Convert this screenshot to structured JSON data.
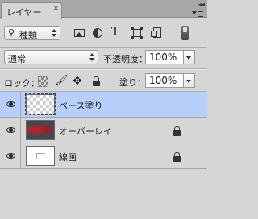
{
  "panel": {
    "tab_label": "レイヤー",
    "tab_close": "✕",
    "collapse": "◂◂"
  },
  "filter": {
    "kind_label": "種類",
    "icons": [
      "pixel-layer-filter-icon",
      "adjustment-layer-filter-icon",
      "type-layer-filter-icon",
      "shape-layer-filter-icon",
      "smart-object-filter-icon"
    ],
    "type_glyph": "T"
  },
  "blend": {
    "mode": "通常",
    "opacity_label": "不透明度：",
    "opacity_value": "100%"
  },
  "lock": {
    "label": "ロック：",
    "fill_label": "塗り：",
    "fill_value": "100%"
  },
  "layers": [
    {
      "name": "ベース塗り",
      "selected": true,
      "locked": false,
      "visible": true
    },
    {
      "name": "オーバーレイ",
      "selected": false,
      "locked": true,
      "visible": true
    },
    {
      "name": "線画",
      "selected": false,
      "locked": true,
      "visible": true
    }
  ],
  "colors": {
    "panel_bg": "#d6d6d6",
    "selected_row": "#b7cffa",
    "header_bg": "#a8a8a8"
  }
}
